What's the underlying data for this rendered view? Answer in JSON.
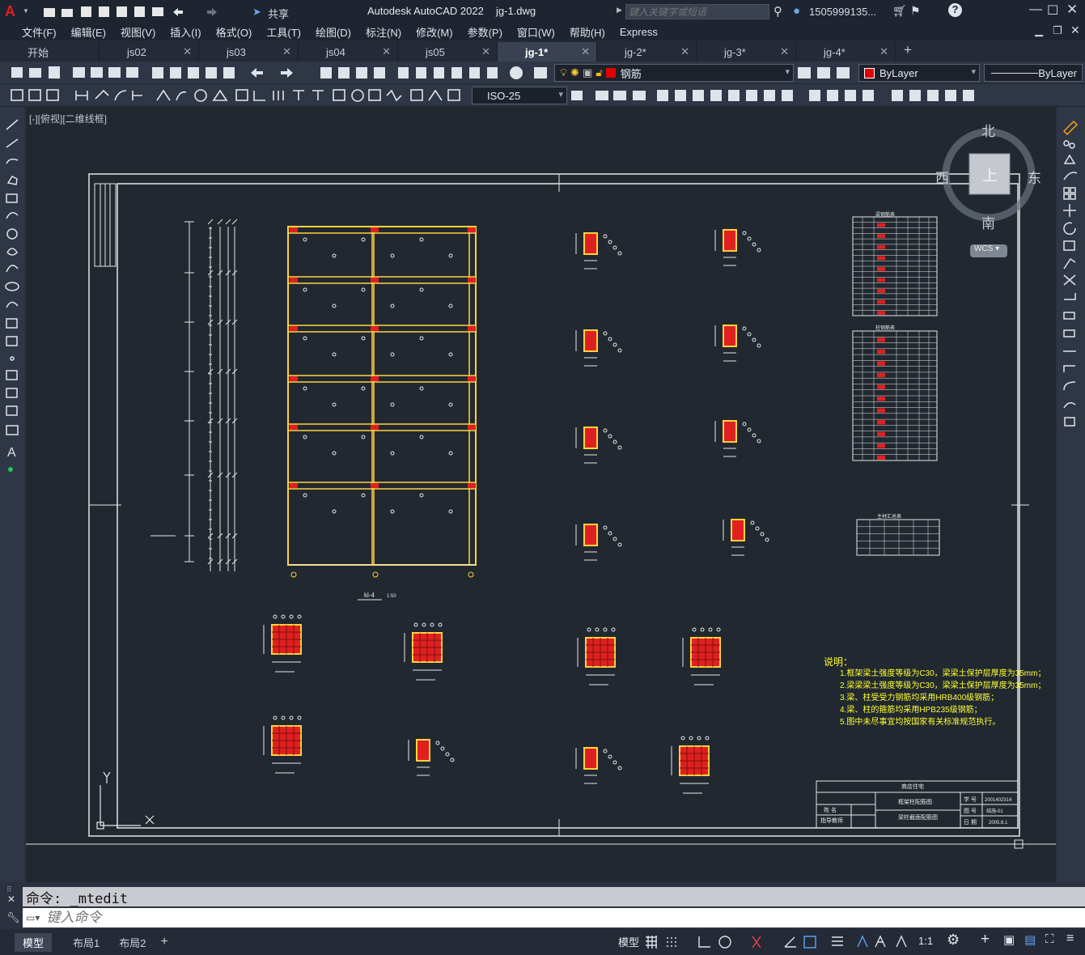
{
  "app": {
    "title": "Autodesk AutoCAD 2022",
    "filename": "jg-1.dwg",
    "search_placeholder": "键入关键字或短语",
    "user": "1505999135...",
    "share": "共享"
  },
  "menu": [
    "文件(F)",
    "编辑(E)",
    "视图(V)",
    "插入(I)",
    "格式(O)",
    "工具(T)",
    "绘图(D)",
    "标注(N)",
    "修改(M)",
    "参数(P)",
    "窗口(W)",
    "帮助(H)",
    "Express"
  ],
  "tabs": [
    {
      "label": "开始"
    },
    {
      "label": "js02"
    },
    {
      "label": "js03"
    },
    {
      "label": "js04"
    },
    {
      "label": "js05"
    },
    {
      "label": "jg-1*",
      "active": true
    },
    {
      "label": "jg-2*"
    },
    {
      "label": "jg-3*"
    },
    {
      "label": "jg-4*"
    }
  ],
  "toolbar": {
    "layer": "钢筋",
    "color": "ByLayer",
    "linetype": "ByLayer",
    "dimstyle": "ISO-25"
  },
  "viewport": {
    "label": "[-][俯视][二维线框]"
  },
  "viewcube": {
    "north": "北",
    "south": "南",
    "east": "东",
    "west": "西",
    "top": "上",
    "wcs": "WCS"
  },
  "drawing": {
    "frame_label": "kl-4",
    "frame_scale": "1:50",
    "notes_title": "说明：",
    "notes": [
      "1.框架梁土强度等级为C30，梁梁土保护层厚度为35mm；",
      "2.梁梁梁土强度等级为C30，梁梁土保护层厚度为35mm；",
      "3.梁、柱受受力钢筋均采用HRB400级钢筋；",
      "4.梁、柱的箍筋均采用HPB235级钢筋；",
      "5.图中未尽事宜均按国家有关标准规范执行。"
    ],
    "table1_title": "梁钢筋表",
    "table2_title": "柱钢筋表",
    "table3_title": "主材汇总表",
    "titleblock": {
      "project": "商店住宅",
      "drawing1": "框架柱配筋图",
      "drawing2": "梁柱截面配筋图",
      "name_label": "姓 名",
      "advisor_label": "指导教师",
      "student_no_label": "学 号",
      "student_no": "2001402314",
      "sheet_label": "图 号",
      "sheet": "结施-01",
      "date_label": "日 期",
      "date": "2005.6.1"
    },
    "sections": [
      "1-1",
      "2-2",
      "3-3",
      "4-4",
      "5-5",
      "6-6",
      "7-7",
      "8-8",
      "9-9",
      "10-10",
      "11-11",
      "12-12",
      "13-13",
      "14-14",
      "15-15",
      "16-16",
      "17-17",
      "18-18",
      "19-19",
      "20-20",
      "21-21",
      "22-22",
      "23-23"
    ]
  },
  "command": {
    "history": "命令: _mtedit",
    "placeholder": "键入命令"
  },
  "status": {
    "layouts": [
      "模型",
      "布局1",
      "布局2"
    ],
    "model": "模型",
    "scale": "1:1"
  },
  "colors": {
    "accent": "#c9ff00",
    "beam": "#ffd23f",
    "rebar": "#e02020",
    "bg": "#212830"
  }
}
